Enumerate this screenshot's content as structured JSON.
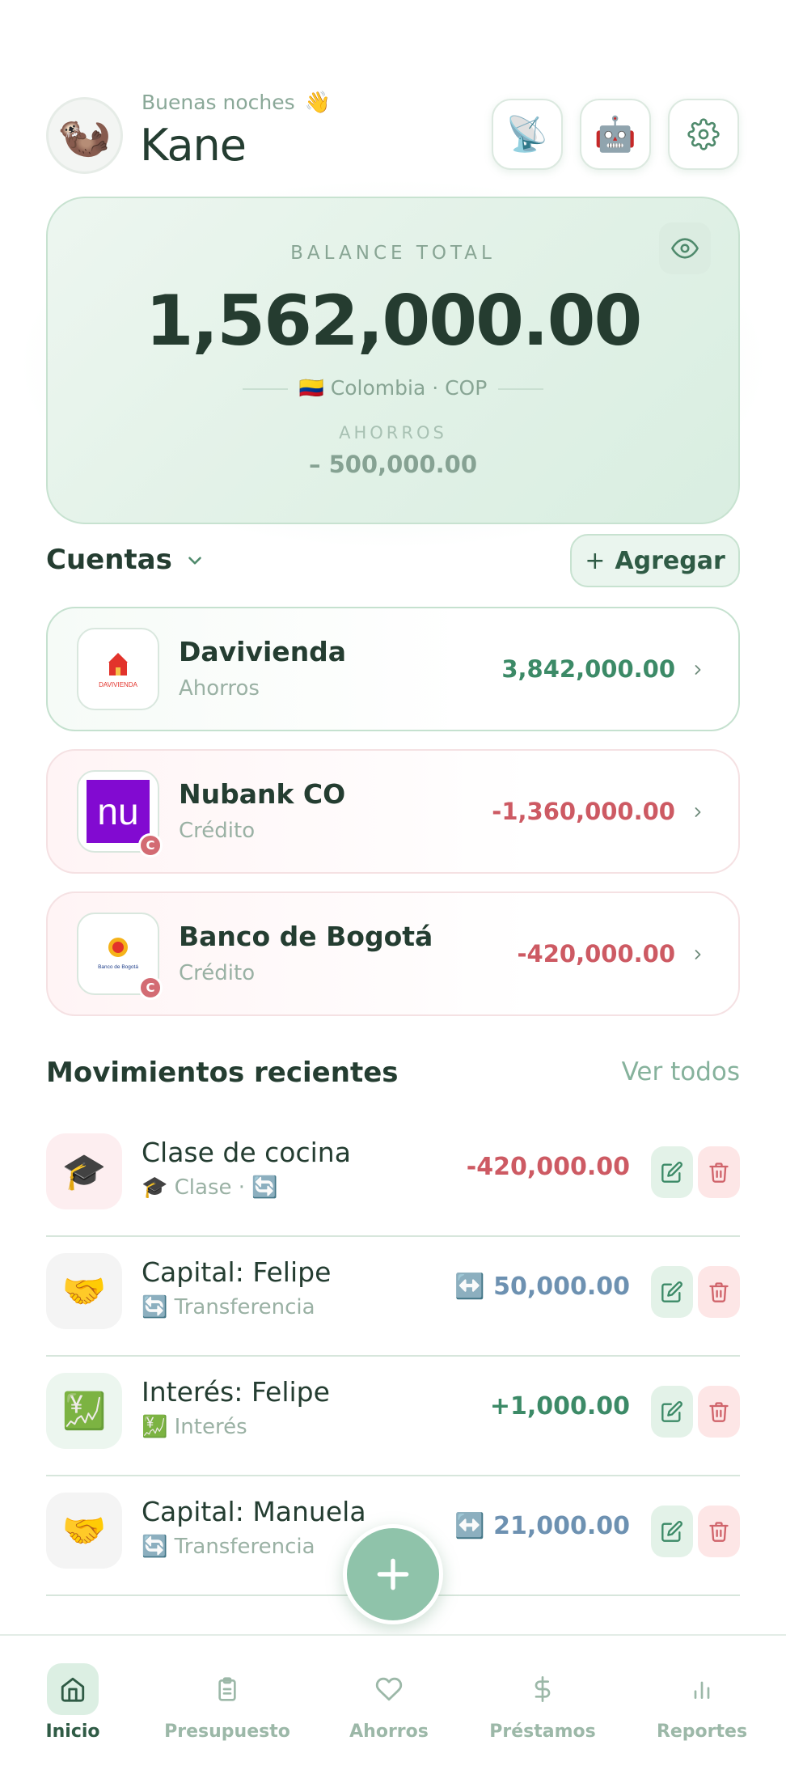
{
  "header": {
    "greeting": "Buenas noches",
    "wave_emoji": "👋",
    "username": "Kane",
    "avatar_emoji": "🦦",
    "buttons": [
      {
        "name": "satellite-icon",
        "glyph": "📡"
      },
      {
        "name": "robot-icon",
        "glyph": "🤖"
      },
      {
        "name": "gear-icon",
        "glyph": ""
      }
    ]
  },
  "balance": {
    "label": "BALANCE TOTAL",
    "amount": "1,562,000.00",
    "flag": "🇨🇴",
    "country": "Colombia · COP",
    "savings_label": "AHORROS",
    "savings_amount": "– 500,000.00"
  },
  "accounts_section": {
    "title": "Cuentas",
    "add_label": "Agregar",
    "add_plus": "+",
    "items": [
      {
        "name": "Davivienda",
        "type": "Ahorros",
        "amount": "3,842,000.00",
        "kind": "pos",
        "logo_text": "DAVIVIENDA",
        "badge": ""
      },
      {
        "name": "Nubank CO",
        "type": "Crédito",
        "amount": "-1,360,000.00",
        "kind": "neg",
        "logo_text": "nu",
        "badge": "C"
      },
      {
        "name": "Banco de Bogotá",
        "type": "Crédito",
        "amount": "-420,000.00",
        "kind": "neg",
        "logo_text": "Banco de Bogotá",
        "badge": "C"
      }
    ]
  },
  "movements_section": {
    "title": "Movimientos recientes",
    "see_all": "Ver todos",
    "items": [
      {
        "icon": "🎓",
        "name": "Clase de cocina",
        "sub": "🎓 Clase · 🔄",
        "amount": "-420,000.00",
        "kind": "neg",
        "bg": "#fdeef0"
      },
      {
        "icon": "🤝",
        "name": "Capital: Felipe",
        "sub": "🔄 Transferencia",
        "amount": "↔️ 50,000.00",
        "kind": "neu",
        "bg": "#f4f4f4"
      },
      {
        "icon": "💹",
        "name": "Interés: Felipe",
        "sub": "💹 Interés",
        "amount": "+1,000.00",
        "kind": "pos",
        "bg": "#ecf6ef"
      },
      {
        "icon": "🤝",
        "name": "Capital: Manuela",
        "sub": "🔄 Transferencia",
        "amount": "↔️ 21,000.00",
        "kind": "neu",
        "bg": "#f4f4f4"
      }
    ]
  },
  "fab": {
    "label": "+"
  },
  "nav": {
    "items": [
      {
        "label": "Inicio",
        "icon": "home-icon",
        "active": true
      },
      {
        "label": "Presupuesto",
        "icon": "clipboard-icon",
        "active": false
      },
      {
        "label": "Ahorros",
        "icon": "heart-icon",
        "active": false
      },
      {
        "label": "Préstamos",
        "icon": "dollar-icon",
        "active": false
      },
      {
        "label": "Reportes",
        "icon": "bar-chart-icon",
        "active": false
      }
    ]
  },
  "colors": {
    "accent": "#8fc3aa",
    "positive": "#3c8a67",
    "negative": "#cd5a63",
    "neutral": "#6d91b1",
    "heading": "#243d31"
  }
}
